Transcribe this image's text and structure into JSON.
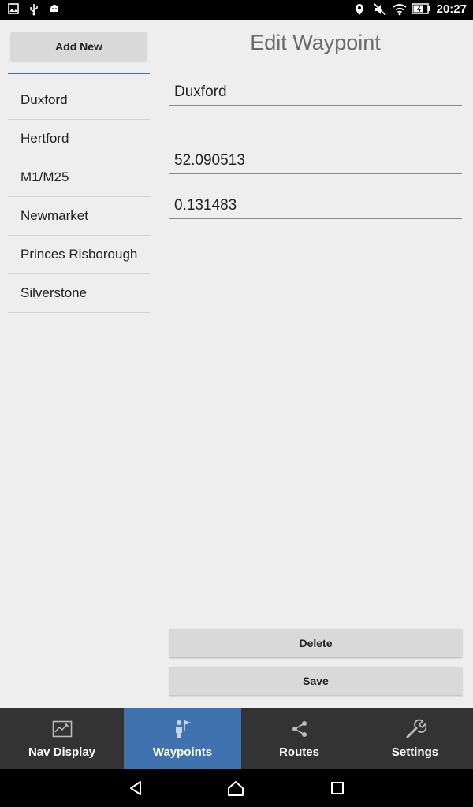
{
  "status_bar": {
    "time": "20:27",
    "left_icons": [
      "image-icon",
      "usb-icon",
      "android-debug-icon"
    ],
    "right_icons": [
      "location-icon",
      "mute-icon",
      "wifi-icon",
      "battery-charging-icon"
    ]
  },
  "left_pane": {
    "add_new_label": "Add New",
    "waypoints": [
      {
        "label": "Duxford"
      },
      {
        "label": "Hertford"
      },
      {
        "label": "M1/M25"
      },
      {
        "label": "Newmarket"
      },
      {
        "label": "Princes Risborough"
      },
      {
        "label": "Silverstone"
      }
    ]
  },
  "edit": {
    "title": "Edit Waypoint",
    "name_value": "Duxford",
    "latitude_value": "52.090513",
    "longitude_value": "0.131483",
    "delete_label": "Delete",
    "save_label": "Save"
  },
  "tabs": [
    {
      "label": "Nav Display",
      "icon": "map-icon",
      "active": false
    },
    {
      "label": "Waypoints",
      "icon": "waypoint-flag-icon",
      "active": true
    },
    {
      "label": "Routes",
      "icon": "share-nodes-icon",
      "active": false
    },
    {
      "label": "Settings",
      "icon": "wrench-icon",
      "active": false
    }
  ],
  "colors": {
    "accent": "#3f72ae",
    "tab_bar_bg": "#333333",
    "content_bg": "#eeeeee",
    "button_bg": "#d9d9d9"
  }
}
